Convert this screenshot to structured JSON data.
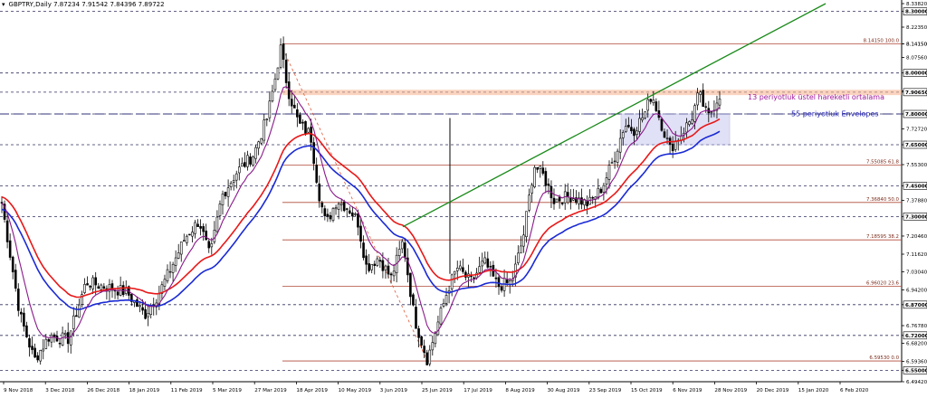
{
  "header": {
    "symbol": "GBPTRY,Daily",
    "ohlc": "7.87234 7.91542 7.84396 7.89722"
  },
  "chart_data": {
    "type": "candlestick",
    "ylim": [
      6.4942,
      8.3382
    ],
    "y_ticks": [
      "8.33820",
      "8.30000",
      "8.22350",
      "8.14150",
      "8.14150",
      "8.07560",
      "8.00000",
      "7.91260",
      "7.90650",
      "7.80000",
      "7.72720",
      "7.65000",
      "7.55300",
      "7.45000",
      "7.37880",
      "7.30000",
      "7.20460",
      "7.11620",
      "7.03040",
      "6.94200",
      "6.87000",
      "6.76780",
      "6.72000",
      "6.68200",
      "6.59360",
      "6.55000",
      "6.49420"
    ],
    "y_tick_values": [
      8.3382,
      8.3,
      8.2235,
      8.1415,
      8.1415,
      8.0756,
      8.0,
      7.9126,
      7.9065,
      7.8,
      7.7272,
      7.65,
      7.553,
      7.45,
      7.3788,
      7.3,
      7.2046,
      7.1162,
      7.0304,
      6.942,
      6.87,
      6.7678,
      6.72,
      6.682,
      6.5936,
      6.55,
      6.4942
    ],
    "highlighted_levels": [
      {
        "value": 8.0,
        "label": "8.00000",
        "color": "#000000"
      },
      {
        "value": 7.9065,
        "label": "7.90650",
        "color": "#000000"
      },
      {
        "value": 7.8,
        "label": "7.80000",
        "color": "#000000"
      },
      {
        "value": 7.65,
        "label": "7.65000",
        "color": "#000000"
      },
      {
        "value": 7.45,
        "label": "7.45000",
        "color": "#000000"
      },
      {
        "value": 7.3,
        "label": "7.30000",
        "color": "#000000"
      },
      {
        "value": 6.87,
        "label": "6.87000",
        "color": "#000000"
      },
      {
        "value": 6.72,
        "label": "6.72000",
        "color": "#000000"
      },
      {
        "value": 6.55,
        "label": "6.55000",
        "color": "#000000"
      },
      {
        "value": 8.3,
        "label": "8.30000",
        "color": "#000000"
      }
    ],
    "x_labels": [
      "9 Nov 2018",
      "3 Dec 2018",
      "26 Dec 2018",
      "18 Jan 2019",
      "11 Feb 2019",
      "5 Mar 2019",
      "27 Mar 2019",
      "18 Apr 2019",
      "10 May 2019",
      "3 Jun 2019",
      "25 Jun 2019",
      "17 Jul 2019",
      "8 Aug 2019",
      "30 Aug 2019",
      "23 Sep 2019",
      "15 Oct 2019",
      "6 Nov 2019",
      "28 Nov 2019",
      "20 Dec 2019",
      "15 Jan 2020",
      "6 Feb 2020"
    ],
    "fib_levels": [
      {
        "label": "8.14150 100.0",
        "value": 8.1415
      },
      {
        "label": "7.55085 61.8",
        "value": 7.55085
      },
      {
        "label": "7.36840 50.0",
        "value": 7.3684
      },
      {
        "label": "7.18595 38.2",
        "value": 7.18595
      },
      {
        "label": "6.96020 23.6",
        "value": 6.9602
      },
      {
        "label": "6.59530 0.0",
        "value": 6.5953
      }
    ],
    "annotations": [
      {
        "text": "13 periyotluk üstel hareketli ortalama",
        "color": "#a0189a"
      },
      {
        "text": "55 periyotluk Envelopes",
        "color": "#2a2ab4"
      }
    ],
    "colors": {
      "ema13": "#8a1a8a",
      "env_upper": "#e81818",
      "env_lower": "#1a2ad4",
      "trend": "#1a8a1a",
      "fib": "#b04a3a",
      "dashed_levels": "#303060",
      "resist_band": "#f5b08a",
      "box": "#c8c8f0"
    },
    "keypoints": [
      [
        0,
        7.42
      ],
      [
        22,
        6.82
      ],
      [
        38,
        6.6
      ],
      [
        55,
        6.72
      ],
      [
        75,
        6.7
      ],
      [
        95,
        6.98
      ],
      [
        115,
        6.96
      ],
      [
        140,
        6.93
      ],
      [
        160,
        6.82
      ],
      [
        175,
        6.92
      ],
      [
        190,
        7.06
      ],
      [
        205,
        7.2
      ],
      [
        220,
        7.28
      ],
      [
        232,
        7.1
      ],
      [
        245,
        7.4
      ],
      [
        262,
        7.52
      ],
      [
        280,
        7.6
      ],
      [
        295,
        7.78
      ],
      [
        303,
        7.95
      ],
      [
        310,
        8.12
      ],
      [
        318,
        7.92
      ],
      [
        330,
        7.75
      ],
      [
        343,
        7.7
      ],
      [
        352,
        7.42
      ],
      [
        360,
        7.26
      ],
      [
        372,
        7.38
      ],
      [
        385,
        7.34
      ],
      [
        395,
        7.28
      ],
      [
        405,
        7.05
      ],
      [
        418,
        7.1
      ],
      [
        432,
        7.0
      ],
      [
        445,
        7.18
      ],
      [
        458,
        6.8
      ],
      [
        472,
        6.6
      ],
      [
        485,
        6.8
      ],
      [
        495,
        6.95
      ],
      [
        505,
        7.05
      ],
      [
        520,
        6.98
      ],
      [
        535,
        7.08
      ],
      [
        550,
        6.96
      ],
      [
        565,
        6.98
      ],
      [
        578,
        7.2
      ],
      [
        590,
        7.55
      ],
      [
        600,
        7.5
      ],
      [
        612,
        7.38
      ],
      [
        630,
        7.4
      ],
      [
        650,
        7.36
      ],
      [
        665,
        7.44
      ],
      [
        678,
        7.58
      ],
      [
        690,
        7.75
      ],
      [
        700,
        7.72
      ],
      [
        712,
        7.8
      ],
      [
        720,
        7.9
      ],
      [
        730,
        7.76
      ],
      [
        740,
        7.63
      ],
      [
        752,
        7.7
      ],
      [
        764,
        7.78
      ],
      [
        772,
        7.9
      ],
      [
        782,
        7.78
      ],
      [
        793,
        7.88
      ],
      [
        797,
        7.91
      ]
    ]
  }
}
